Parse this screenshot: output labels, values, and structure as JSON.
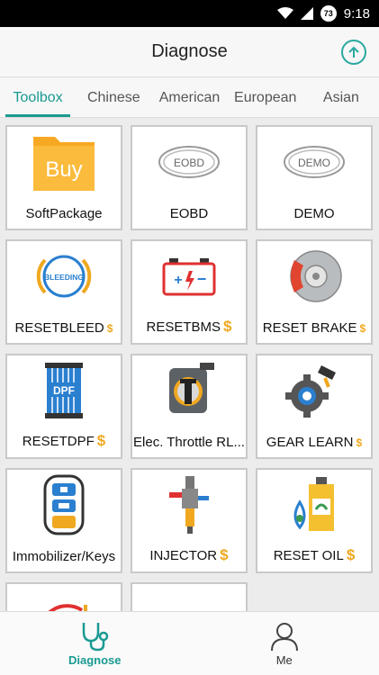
{
  "status_bar": {
    "battery_level": "73",
    "time": "9:18"
  },
  "header": {
    "title": "Diagnose",
    "upload_icon": "arrow-up-circle"
  },
  "tabs": [
    {
      "label": "Toolbox",
      "active": true
    },
    {
      "label": "Chinese",
      "active": false
    },
    {
      "label": "American",
      "active": false
    },
    {
      "label": "European",
      "active": false
    },
    {
      "label": "Asian",
      "active": false
    }
  ],
  "tiles": [
    {
      "label": "SoftPackage",
      "icon": "folder-buy-icon",
      "icon_text": "Buy",
      "paid": false
    },
    {
      "label": "EOBD",
      "icon": "eobd-badge-icon",
      "icon_text": "EOBD",
      "paid": false
    },
    {
      "label": "DEMO",
      "icon": "demo-badge-icon",
      "icon_text": "DEMO",
      "paid": false
    },
    {
      "label": "RESETBLEED",
      "icon": "bleeding-icon",
      "icon_text": "BLEEDING",
      "paid": true
    },
    {
      "label": "RESETBMS",
      "icon": "battery-icon",
      "paid": true
    },
    {
      "label": "RESET BRAKE",
      "icon": "brake-disc-icon",
      "paid": true
    },
    {
      "label": "RESETDPF",
      "icon": "dpf-filter-icon",
      "icon_text": "DPF",
      "paid": true
    },
    {
      "label": "Elec. Throttle RL...",
      "icon": "throttle-body-icon",
      "paid": false
    },
    {
      "label": "GEAR LEARN",
      "icon": "gear-learn-icon",
      "paid": true
    },
    {
      "label": "Immobilizer/Keys",
      "icon": "car-key-icon",
      "paid": false
    },
    {
      "label": "INJECTOR",
      "icon": "injector-icon",
      "paid": true
    },
    {
      "label": "RESET OIL",
      "icon": "oil-bottle-icon",
      "paid": true
    },
    {
      "label": "",
      "icon": "partial-red-gauge-icon",
      "paid": false
    },
    {
      "label": "",
      "icon": "partial-yellow-ring-icon",
      "paid": false
    }
  ],
  "paid_symbol": "$",
  "bottom_nav": [
    {
      "label": "Diagnose",
      "icon": "stethoscope-icon",
      "active": true
    },
    {
      "label": "Me",
      "icon": "user-icon",
      "active": false
    }
  ],
  "colors": {
    "accent": "#1a9a92",
    "paid": "#f0a820",
    "tile_border": "#c9c9c9"
  }
}
